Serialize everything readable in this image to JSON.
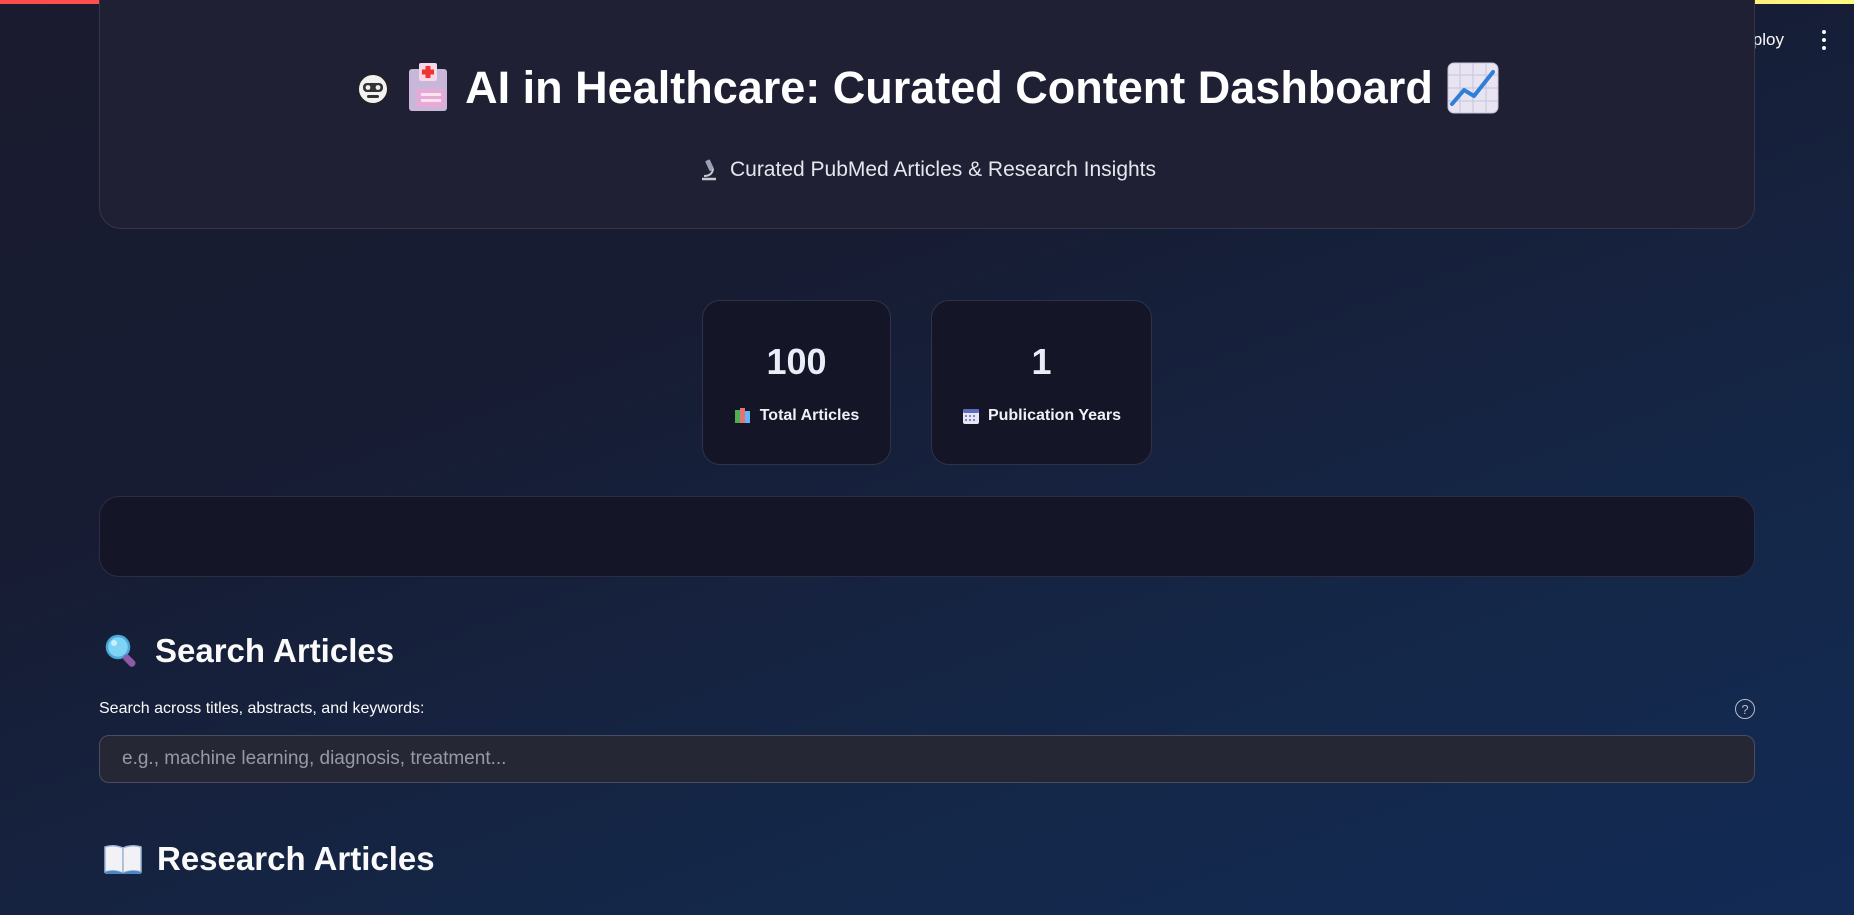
{
  "app": {
    "deploy_label": "Deploy",
    "accent_colors": [
      "#ff4b4b",
      "#fffd80"
    ]
  },
  "header": {
    "title": "AI in Healthcare: Curated Content Dashboard",
    "subtitle": "Curated PubMed Articles & Research Insights",
    "icons": [
      "robot-face-icon",
      "hospital-icon",
      "chart-increasing-icon",
      "microscope-icon"
    ]
  },
  "metrics": [
    {
      "value": "100",
      "label": "Total Articles",
      "icon": "books-icon"
    },
    {
      "value": "1",
      "label": "Publication Years",
      "icon": "calendar-icon"
    }
  ],
  "search": {
    "heading": "Search Articles",
    "heading_icon": "magnifying-glass-icon",
    "label": "Search across titles, abstracts, and keywords:",
    "placeholder": "e.g., machine learning, diagnosis, treatment...",
    "value": ""
  },
  "articles": {
    "heading": "Research Articles",
    "heading_icon": "open-book-icon"
  }
}
